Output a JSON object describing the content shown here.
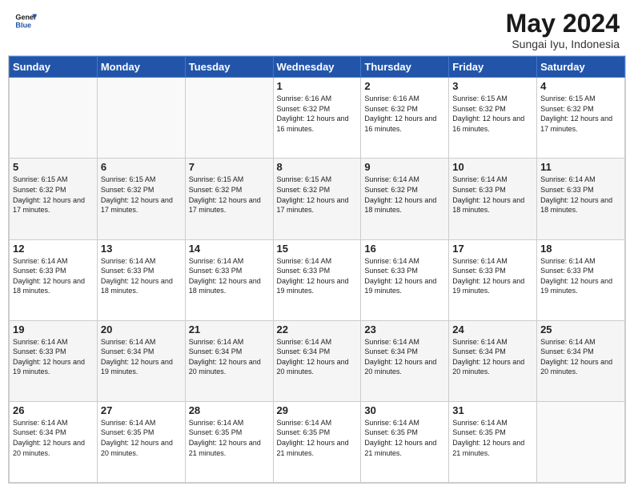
{
  "header": {
    "logo_line1": "General",
    "logo_line2": "Blue",
    "month_year": "May 2024",
    "location": "Sungai Iyu, Indonesia"
  },
  "days_of_week": [
    "Sunday",
    "Monday",
    "Tuesday",
    "Wednesday",
    "Thursday",
    "Friday",
    "Saturday"
  ],
  "weeks": [
    [
      {
        "day": "",
        "info": ""
      },
      {
        "day": "",
        "info": ""
      },
      {
        "day": "",
        "info": ""
      },
      {
        "day": "1",
        "info": "Sunrise: 6:16 AM\nSunset: 6:32 PM\nDaylight: 12 hours and 16 minutes."
      },
      {
        "day": "2",
        "info": "Sunrise: 6:16 AM\nSunset: 6:32 PM\nDaylight: 12 hours and 16 minutes."
      },
      {
        "day": "3",
        "info": "Sunrise: 6:15 AM\nSunset: 6:32 PM\nDaylight: 12 hours and 16 minutes."
      },
      {
        "day": "4",
        "info": "Sunrise: 6:15 AM\nSunset: 6:32 PM\nDaylight: 12 hours and 17 minutes."
      }
    ],
    [
      {
        "day": "5",
        "info": "Sunrise: 6:15 AM\nSunset: 6:32 PM\nDaylight: 12 hours and 17 minutes."
      },
      {
        "day": "6",
        "info": "Sunrise: 6:15 AM\nSunset: 6:32 PM\nDaylight: 12 hours and 17 minutes."
      },
      {
        "day": "7",
        "info": "Sunrise: 6:15 AM\nSunset: 6:32 PM\nDaylight: 12 hours and 17 minutes."
      },
      {
        "day": "8",
        "info": "Sunrise: 6:15 AM\nSunset: 6:32 PM\nDaylight: 12 hours and 17 minutes."
      },
      {
        "day": "9",
        "info": "Sunrise: 6:14 AM\nSunset: 6:32 PM\nDaylight: 12 hours and 18 minutes."
      },
      {
        "day": "10",
        "info": "Sunrise: 6:14 AM\nSunset: 6:33 PM\nDaylight: 12 hours and 18 minutes."
      },
      {
        "day": "11",
        "info": "Sunrise: 6:14 AM\nSunset: 6:33 PM\nDaylight: 12 hours and 18 minutes."
      }
    ],
    [
      {
        "day": "12",
        "info": "Sunrise: 6:14 AM\nSunset: 6:33 PM\nDaylight: 12 hours and 18 minutes."
      },
      {
        "day": "13",
        "info": "Sunrise: 6:14 AM\nSunset: 6:33 PM\nDaylight: 12 hours and 18 minutes."
      },
      {
        "day": "14",
        "info": "Sunrise: 6:14 AM\nSunset: 6:33 PM\nDaylight: 12 hours and 18 minutes."
      },
      {
        "day": "15",
        "info": "Sunrise: 6:14 AM\nSunset: 6:33 PM\nDaylight: 12 hours and 19 minutes."
      },
      {
        "day": "16",
        "info": "Sunrise: 6:14 AM\nSunset: 6:33 PM\nDaylight: 12 hours and 19 minutes."
      },
      {
        "day": "17",
        "info": "Sunrise: 6:14 AM\nSunset: 6:33 PM\nDaylight: 12 hours and 19 minutes."
      },
      {
        "day": "18",
        "info": "Sunrise: 6:14 AM\nSunset: 6:33 PM\nDaylight: 12 hours and 19 minutes."
      }
    ],
    [
      {
        "day": "19",
        "info": "Sunrise: 6:14 AM\nSunset: 6:33 PM\nDaylight: 12 hours and 19 minutes."
      },
      {
        "day": "20",
        "info": "Sunrise: 6:14 AM\nSunset: 6:34 PM\nDaylight: 12 hours and 19 minutes."
      },
      {
        "day": "21",
        "info": "Sunrise: 6:14 AM\nSunset: 6:34 PM\nDaylight: 12 hours and 20 minutes."
      },
      {
        "day": "22",
        "info": "Sunrise: 6:14 AM\nSunset: 6:34 PM\nDaylight: 12 hours and 20 minutes."
      },
      {
        "day": "23",
        "info": "Sunrise: 6:14 AM\nSunset: 6:34 PM\nDaylight: 12 hours and 20 minutes."
      },
      {
        "day": "24",
        "info": "Sunrise: 6:14 AM\nSunset: 6:34 PM\nDaylight: 12 hours and 20 minutes."
      },
      {
        "day": "25",
        "info": "Sunrise: 6:14 AM\nSunset: 6:34 PM\nDaylight: 12 hours and 20 minutes."
      }
    ],
    [
      {
        "day": "26",
        "info": "Sunrise: 6:14 AM\nSunset: 6:34 PM\nDaylight: 12 hours and 20 minutes."
      },
      {
        "day": "27",
        "info": "Sunrise: 6:14 AM\nSunset: 6:35 PM\nDaylight: 12 hours and 20 minutes."
      },
      {
        "day": "28",
        "info": "Sunrise: 6:14 AM\nSunset: 6:35 PM\nDaylight: 12 hours and 21 minutes."
      },
      {
        "day": "29",
        "info": "Sunrise: 6:14 AM\nSunset: 6:35 PM\nDaylight: 12 hours and 21 minutes."
      },
      {
        "day": "30",
        "info": "Sunrise: 6:14 AM\nSunset: 6:35 PM\nDaylight: 12 hours and 21 minutes."
      },
      {
        "day": "31",
        "info": "Sunrise: 6:14 AM\nSunset: 6:35 PM\nDaylight: 12 hours and 21 minutes."
      },
      {
        "day": "",
        "info": ""
      }
    ]
  ]
}
